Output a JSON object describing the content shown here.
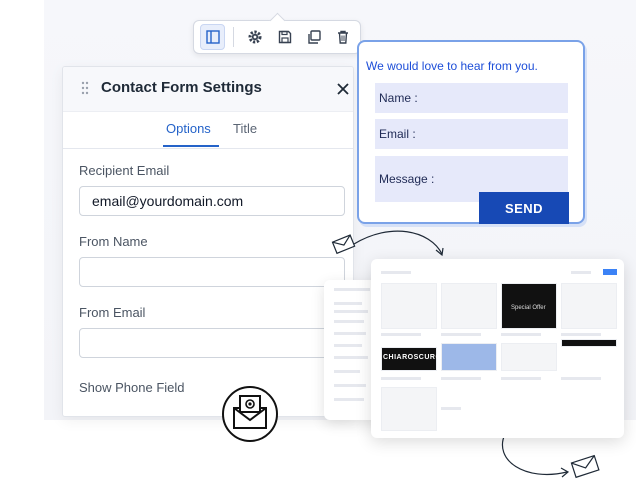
{
  "toolbar": {
    "buttons": [
      {
        "icon": "sidebar-panel-icon",
        "active": true
      },
      {
        "icon": "gear-icon"
      },
      {
        "icon": "save-icon"
      },
      {
        "icon": "duplicate-icon"
      },
      {
        "icon": "trash-icon"
      }
    ]
  },
  "panel": {
    "title": "Contact Form Settings",
    "tabs": [
      {
        "label": "Options",
        "active": true
      },
      {
        "label": "Title",
        "active": false
      }
    ],
    "fields": {
      "recipient_label": "Recipient Email",
      "recipient_value": "email@yourdomain.com",
      "from_name_label": "From Name",
      "from_name_value": "",
      "from_email_label": "From Email",
      "from_email_value": "",
      "phone_label": "Show Phone Field"
    }
  },
  "form_preview": {
    "heading": "We would love to hear from you.",
    "name_label": "Name :",
    "email_label": "Email :",
    "message_label": "Message :",
    "send_label": "SEND"
  },
  "mini_preview": {
    "brand_text": "CHIAROSCURO",
    "offer_text": "Special Offer"
  },
  "colors": {
    "accent": "#2563c9",
    "send_button": "#1749b5",
    "form_border": "#7aa2e8",
    "field_fill": "#e6e9fa"
  }
}
